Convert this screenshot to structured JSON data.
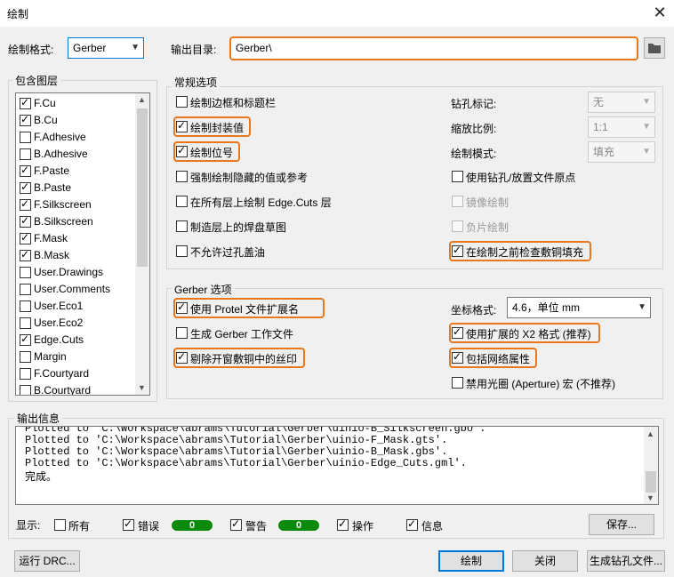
{
  "window": {
    "title": "绘制",
    "close_glyph": "✕"
  },
  "format": {
    "label": "绘制格式:",
    "value": "Gerber"
  },
  "output_dir": {
    "label": "输出目录:",
    "value": "Gerber\\"
  },
  "layers": {
    "title": "包含图层",
    "items": [
      {
        "name": "F.Cu",
        "checked": true
      },
      {
        "name": "B.Cu",
        "checked": true
      },
      {
        "name": "F.Adhesive",
        "checked": false
      },
      {
        "name": "B.Adhesive",
        "checked": false
      },
      {
        "name": "F.Paste",
        "checked": true
      },
      {
        "name": "B.Paste",
        "checked": true
      },
      {
        "name": "F.Silkscreen",
        "checked": true
      },
      {
        "name": "B.Silkscreen",
        "checked": true
      },
      {
        "name": "F.Mask",
        "checked": true
      },
      {
        "name": "B.Mask",
        "checked": true
      },
      {
        "name": "User.Drawings",
        "checked": false
      },
      {
        "name": "User.Comments",
        "checked": false
      },
      {
        "name": "User.Eco1",
        "checked": false
      },
      {
        "name": "User.Eco2",
        "checked": false
      },
      {
        "name": "Edge.Cuts",
        "checked": true
      },
      {
        "name": "Margin",
        "checked": false
      },
      {
        "name": "F.Courtyard",
        "checked": false
      },
      {
        "name": "B.Courtyard",
        "checked": false
      }
    ]
  },
  "general": {
    "title": "常规选项",
    "left": [
      {
        "label": "绘制边框和标题栏",
        "checked": false,
        "highlighted": false
      },
      {
        "label": "绘制封装值",
        "checked": true,
        "highlighted": true
      },
      {
        "label": "绘制位号",
        "checked": true,
        "highlighted": true
      },
      {
        "label": "强制绘制隐藏的值或参考",
        "checked": false,
        "highlighted": false
      },
      {
        "label": "在所有层上绘制 Edge.Cuts 层",
        "checked": false,
        "highlighted": false
      },
      {
        "label": "制造层上的焊盘草图",
        "checked": false,
        "highlighted": false
      },
      {
        "label": "不允许过孔盖油",
        "checked": false,
        "highlighted": false
      }
    ],
    "drill_marks": {
      "label": "钻孔标记:",
      "value": "无"
    },
    "scale": {
      "label": "缩放比例:",
      "value": "1:1"
    },
    "plot_mode": {
      "label": "绘制模式:",
      "value": "填充"
    },
    "right": [
      {
        "label": "使用钻孔/放置文件原点",
        "checked": false,
        "disabled": false,
        "highlighted": false
      },
      {
        "label": "镜像绘制",
        "checked": false,
        "disabled": true,
        "highlighted": false
      },
      {
        "label": "负片绘制",
        "checked": false,
        "disabled": true,
        "highlighted": false
      },
      {
        "label": "在绘制之前检查敷铜填充",
        "checked": true,
        "disabled": false,
        "highlighted": true
      }
    ]
  },
  "gerber": {
    "title": "Gerber 选项",
    "left": [
      {
        "label": "使用 Protel 文件扩展名",
        "checked": true,
        "highlighted": true
      },
      {
        "label": "生成 Gerber 工作文件",
        "checked": false,
        "highlighted": false
      },
      {
        "label": "剔除开窗敷铜中的丝印",
        "checked": true,
        "highlighted": true
      }
    ],
    "coord_format": {
      "label": "坐标格式:",
      "value": "4.6，单位 mm"
    },
    "right": [
      {
        "label": "使用扩展的 X2 格式 (推荐)",
        "checked": true,
        "highlighted": true
      },
      {
        "label": "包括网络属性",
        "checked": true,
        "highlighted": true
      },
      {
        "label": "禁用光圈 (Aperture) 宏 (不推荐)",
        "checked": false,
        "highlighted": false
      }
    ]
  },
  "messages": {
    "title": "输出信息",
    "lines": [
      "Plotted to 'C:\\Workspace\\abrams\\Tutorial\\Gerber\\uinio-B_Silkscreen.gbo'.",
      "Plotted to 'C:\\Workspace\\abrams\\Tutorial\\Gerber\\uinio-F_Mask.gts'.",
      "Plotted to 'C:\\Workspace\\abrams\\Tutorial\\Gerber\\uinio-B_Mask.gbs'.",
      "Plotted to 'C:\\Workspace\\abrams\\Tutorial\\Gerber\\uinio-Edge_Cuts.gml'.",
      "完成。"
    ]
  },
  "filters": {
    "show_label": "显示:",
    "all": {
      "label": "所有",
      "checked": false
    },
    "errors": {
      "label": "错误",
      "checked": true,
      "count": "0"
    },
    "warnings": {
      "label": "警告",
      "checked": true,
      "count": "0"
    },
    "actions": {
      "label": "操作",
      "checked": true
    },
    "infos": {
      "label": "信息",
      "checked": true
    },
    "save_label": "保存..."
  },
  "buttons": {
    "run_drc": "运行 DRC...",
    "plot": "绘制",
    "close": "关闭",
    "gen_drill": "生成钻孔文件..."
  },
  "colors": {
    "highlight": "#e8771e",
    "badge": "#0a8a0a",
    "accent": "#0078d7"
  }
}
